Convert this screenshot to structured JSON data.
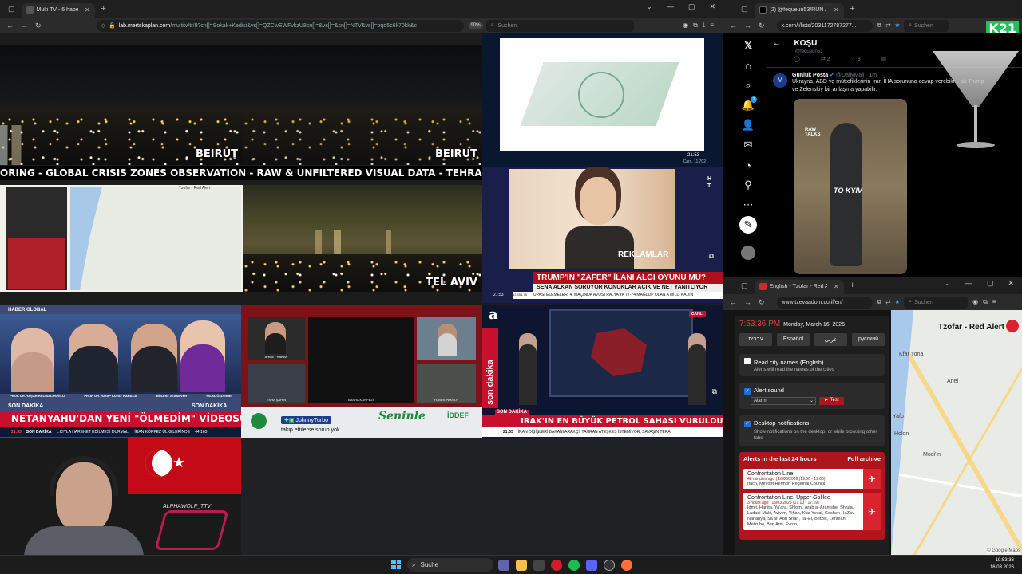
{
  "left_browser": {
    "tab_title": "Multi TV - 6 haber kanalı",
    "url_host": "lab.mertskaplan.com",
    "url_path": "/multitv/tr/9?cn[]=Sokak+Kedisi&vs[]=QZCwEWFvkzU8cn[]=&vs[]=&cn[]=NTV&vs[]=pqq5c6k70kk&c",
    "zoom": "90%",
    "search_placeholder": "Suchen"
  },
  "tiles": {
    "beirut_label_1": "BEIRUT",
    "beirut_label_2": "BEIRUT",
    "ticker": "ORING - GLOBAL CRISIS ZONES OBSERVATION - RAW & UNFILTERED VISUAL DATA - TEHRA",
    "telaviv_label": "TEL AVIV",
    "redalert_mini_title": "Tzofar - Red Alert",
    "ad_time": "21:53",
    "ad_sub": "Çarş. 11.702",
    "ht_logo": "H T",
    "reklamlar": "REKLAMLAR",
    "ht_headline": "TRUMP'IN \"ZAFER\" İLANI ALGI OYUNU MU?",
    "ht_subline": "SENA ALKAN SORUYOR KONUKLAR AÇIK VE NET YANITLIYOR",
    "ht_crawl": "UPASI ELEMELERİ 4. MAÇINDA AVUSTRALYA'YA 77-74 MAĞLUP OLAN A MİLLİ KADIN",
    "ht_time": "21:53",
    "ht_num": "12,556.75",
    "hg_logo": "HABER GLOBAL",
    "hg_guests": [
      "PROF. DR. YAŞAR HACISALİHOĞLU",
      "PROF. DR. RAGIP KUTAY KARACA",
      "BÜLENT ATASEVER",
      "HİLAL ÖZDEMİR"
    ],
    "hg_son_dakika_1": "SON DAKİKA",
    "hg_son_dakika_2": "SON DAKİKA",
    "hg_headline": "NETANYAHU'DAN YENİ \"ÖLMEDİM\" VİDEOSU MU?",
    "hg_time": "21:53",
    "hg_crawl_1": "SON DAKİKA",
    "hg_crawl_2": "...CIYLA HAREKET EDİLMESİ DURMALI",
    "hg_crawl_3": "İRAN KÖRFEZ ÜLKELERİNDE",
    "hg_crawl_num": "44,163",
    "mid_names": [
      "AHMET HAKAN",
      "BASRA KÖRFEZİ",
      "ESRA ŞAHİN",
      "YUNUS PAKSOY"
    ],
    "mid_chat_user": "JohnnyTurbo",
    "mid_chat_msg": "takip ettilerse sorun yok",
    "mid_brand": "Seninle",
    "mid_brand2": "İDDEF",
    "a_logo": "a",
    "a_canli": "CANLI",
    "a_son_dakika": "son dakika",
    "a_son_dakika_small": "SON DAKİKA",
    "a_headline": "IRAK'IN EN BÜYÜK PETROL SAHASI VURULDU",
    "a_time": "21:53",
    "a_crawl": "İRAN DIŞİŞLERİ BAKANI ARAKÇİ: TAHRAN ATEŞKES İSTEMİYOR, SAVAŞIN TERA",
    "webcam_tag": "ALPHAWOLF_TTV"
  },
  "x_browser": {
    "tab_title": "(2) @fequeun53/RUN / X",
    "url": "x.com/i/lists/2031172787277...",
    "search_placeholder": "Suchen",
    "list_title": "KOŞU",
    "list_handle": "@fequeun53",
    "stats": [
      "2",
      "8"
    ],
    "post_author": "Günlük Posta",
    "post_handle": "@DailyMail",
    "post_age": "1m",
    "post_text": "Ukrayna, ABD ve müttefiklerinin İran İHA sorununa cevap verebilir... ak Trump ve Zelenskiy bir anlaşma yapabilir.",
    "image_caption": "TO KYIV",
    "image_brand": "RAW TALKS",
    "notification_count": "2",
    "k21_logo": "K21"
  },
  "tzofar_browser": {
    "tab_title": "English - Tzofar - Red Alert",
    "url": "www.tzevaadom.co.il/en/",
    "search_placeholder": "Suchen",
    "clock": "7:53:36 PM",
    "date": "Monday, March 16, 2026",
    "languages": [
      "עברית",
      "Español",
      "عربي",
      "русский"
    ],
    "read_names_title": "Read city names (English)",
    "read_names_sub": "Alerts will read the names of the cities",
    "alert_sound_title": "Alert sound",
    "alert_sound_value": "Alarm",
    "test_button": "► Test",
    "desktop_title": "Desktop notifications",
    "desktop_sub": "Show notifications on the desktop, or while browsing other tabs",
    "alerts_header": "Alerts in the last 24 hours",
    "full_archive": "Full archive",
    "alerts": [
      {
        "title": "Confrontation Line",
        "meta": "48 minutes ago | 16/03/2026 (19:06 - 19:06)",
        "areas": "Ifach, Mevoot Hermon Regional Council"
      },
      {
        "title": "Confrontation Line, Upper Galilee",
        "meta": "3 hours ago | 16/03/2026 (17:10 - 17:19)",
        "areas": "Idmit, Hanita, Ya'ara, Shlomi, Arab al-Aramshe, Shtula, Ladadi-Maki, Avivim, Yiftah, Kfar Yuval, Goshen HaZav, Nahariya, Sa'ar, Abu Snan, Tal-El, Betzet, Lehman, Metzuba, Ben Ami, Evron,"
      }
    ],
    "map_title": "Tzofar - Red Alert",
    "map_places": [
      "Kfar Yona",
      "Ariel",
      "Yafo",
      "Holon",
      "Modi'in"
    ],
    "map_attribution": "© Google Maps",
    "k21_logo": "K21"
  },
  "taskbar": {
    "search_label": "Suche",
    "time": "19:53:36",
    "date": "16.03.2026"
  },
  "colors": {
    "news_red": "#c8102e",
    "tzofar_red": "#d9232e",
    "tzofar_bg": "#1e1e1e",
    "accent_blue": "#1e6fd9"
  }
}
